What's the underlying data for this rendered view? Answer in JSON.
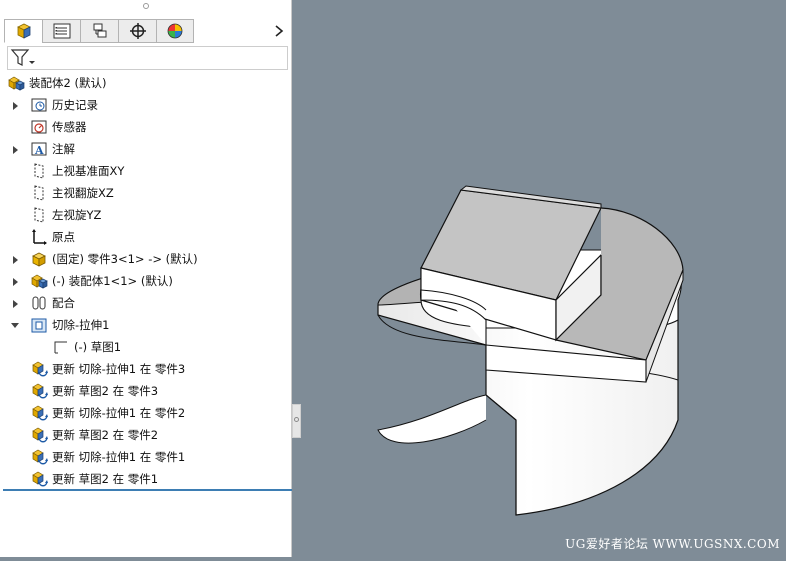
{
  "feature_manager": {
    "tabs": [
      {
        "name": "feature-tree-tab"
      },
      {
        "name": "property-tab"
      },
      {
        "name": "configuration-tab"
      },
      {
        "name": "dimxpert-tab"
      },
      {
        "name": "display-tab"
      }
    ],
    "more_glyph": "›",
    "tree": [
      {
        "label": "装配体2 (默认)",
        "icon": "assembly-icon",
        "indent": 0,
        "arrow": "none"
      },
      {
        "label": "历史记录",
        "icon": "history-icon",
        "indent": 1,
        "arrow": "right"
      },
      {
        "label": "传感器",
        "icon": "sensor-icon",
        "indent": 1,
        "arrow": "none"
      },
      {
        "label": "注解",
        "icon": "annotation-icon",
        "indent": 1,
        "arrow": "right"
      },
      {
        "label": "上视基准面XY",
        "icon": "plane-icon",
        "indent": 1,
        "arrow": "none"
      },
      {
        "label": "主视翻旋XZ",
        "icon": "plane-icon",
        "indent": 1,
        "arrow": "none"
      },
      {
        "label": "左视旋YZ",
        "icon": "plane-icon",
        "indent": 1,
        "arrow": "none"
      },
      {
        "label": "原点",
        "icon": "origin-icon",
        "indent": 1,
        "arrow": "none"
      },
      {
        "label": "(固定) 零件3<1> -> (默认)",
        "icon": "part-icon",
        "indent": 1,
        "arrow": "right"
      },
      {
        "label": "(-) 装配体1<1> (默认)",
        "icon": "assembly-icon",
        "indent": 1,
        "arrow": "right"
      },
      {
        "label": "配合",
        "icon": "mate-icon",
        "indent": 1,
        "arrow": "right"
      },
      {
        "label": "切除-拉伸1",
        "icon": "cut-extrude-icon",
        "indent": 1,
        "arrow": "down"
      },
      {
        "label": "(-) 草图1",
        "icon": "sketch-icon",
        "indent": 2,
        "arrow": "none"
      },
      {
        "label": "更新 切除-拉伸1 在 零件3",
        "icon": "update-icon",
        "indent": 1,
        "arrow": "none"
      },
      {
        "label": "更新 草图2 在 零件3",
        "icon": "update-icon",
        "indent": 1,
        "arrow": "none"
      },
      {
        "label": "更新 切除-拉伸1 在 零件2",
        "icon": "update-icon",
        "indent": 1,
        "arrow": "none"
      },
      {
        "label": "更新 草图2 在 零件2",
        "icon": "update-icon",
        "indent": 1,
        "arrow": "none"
      },
      {
        "label": "更新 切除-拉伸1 在 零件1",
        "icon": "update-icon",
        "indent": 1,
        "arrow": "none"
      },
      {
        "label": "更新 草图2 在 零件1",
        "icon": "update-icon",
        "indent": 1,
        "arrow": "none"
      }
    ]
  },
  "viewport": {
    "background": "#7f8c97",
    "watermark": "UG爱好者论坛 WWW.UGSNX.COM"
  },
  "colors": {
    "accent": "#3d7db3",
    "part_yellow": "#f2c230"
  }
}
